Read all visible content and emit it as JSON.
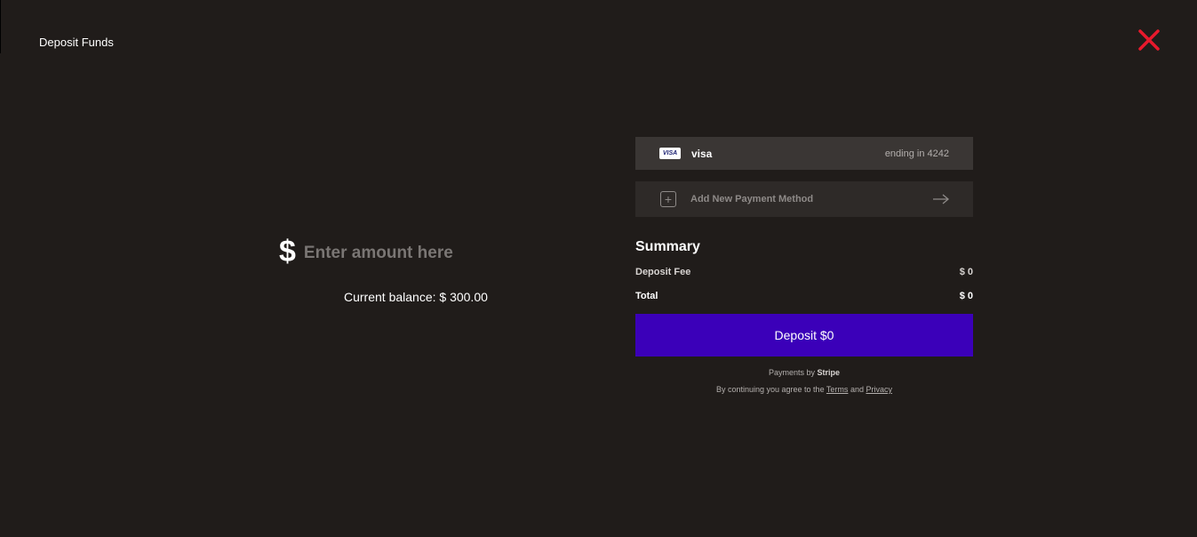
{
  "header": {
    "title": "Deposit Funds",
    "close_icon": "close-x-icon",
    "close_color": "#e8192c"
  },
  "amount": {
    "currency_symbol": "$",
    "placeholder": "Enter amount here",
    "value": "",
    "balance_text": "Current balance: $ 300.00"
  },
  "payment_methods": {
    "saved_card": {
      "icon": "visa-card-icon",
      "badge": "VISA",
      "brand": "visa",
      "ending": "ending in 4242"
    },
    "add_new": {
      "icon": "plus-square-icon",
      "label": "Add New Payment Method",
      "arrow_icon": "arrow-right-icon"
    }
  },
  "summary": {
    "title": "Summary",
    "fee_label": "Deposit Fee",
    "fee_value": "$ 0",
    "total_label": "Total",
    "total_value": "$ 0"
  },
  "deposit_button": {
    "label": "Deposit $0",
    "color": "#3b00b9"
  },
  "footer": {
    "payments_by": "Payments by",
    "provider": "Stripe",
    "agree_prefix": "By continuing you agree to the",
    "terms": "Terms",
    "and": "and",
    "privacy": "Privacy"
  }
}
